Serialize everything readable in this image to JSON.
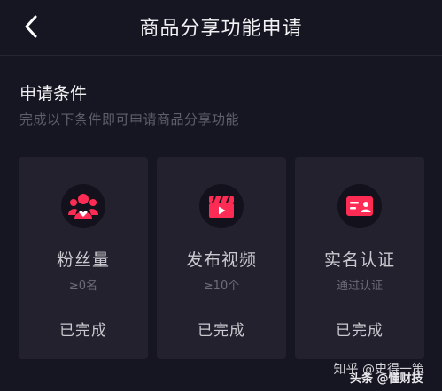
{
  "nav": {
    "title": "商品分享功能申请",
    "back_icon": "chevron-left-icon"
  },
  "section": {
    "title": "申请条件",
    "subtitle": "完成以下条件即可申请商品分享功能"
  },
  "cards": [
    {
      "label": "粉丝量",
      "requirement": "≥0名",
      "status": "已完成",
      "icon": "fans-icon"
    },
    {
      "label": "发布视频",
      "requirement": "≥10个",
      "status": "已完成",
      "icon": "video-clapper-icon"
    },
    {
      "label": "实名认证",
      "requirement": "通过认证",
      "status": "已完成",
      "icon": "id-card-icon"
    }
  ],
  "watermark": {
    "text": "知乎 @史得一策",
    "logo_text": "头条 @懂财技"
  },
  "colors": {
    "background": "#161622",
    "card": "#22212d",
    "accent": "#fe2c55"
  }
}
